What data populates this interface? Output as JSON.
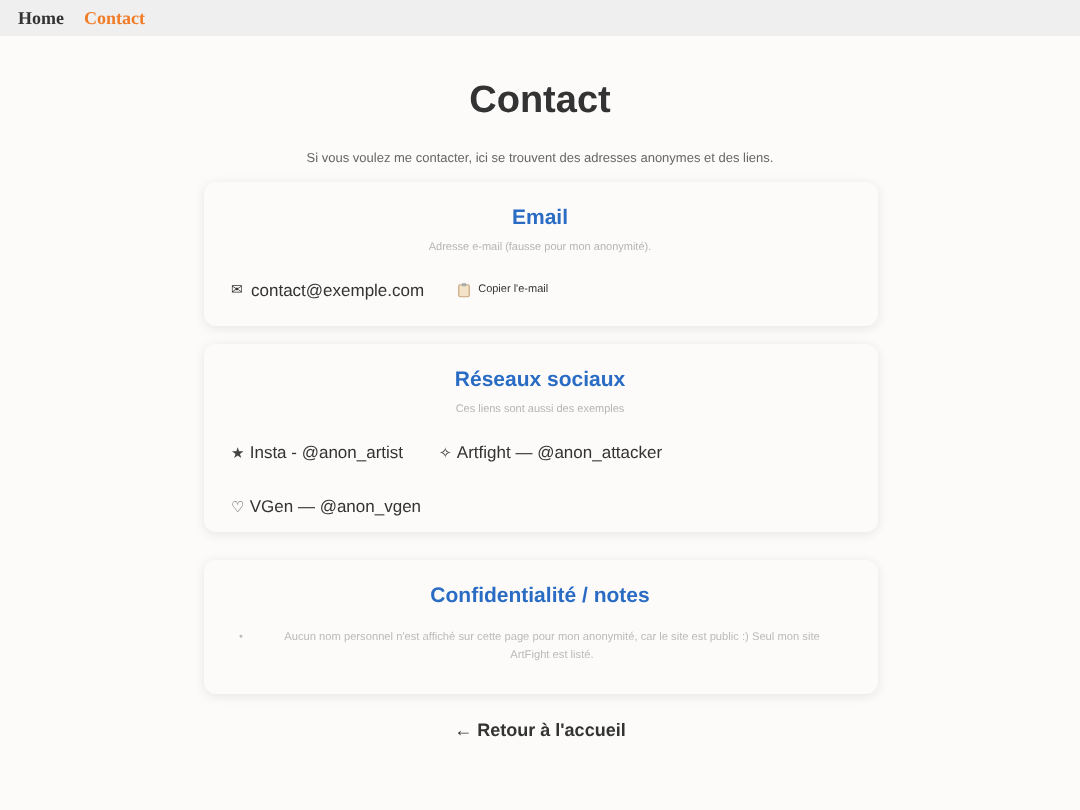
{
  "nav": [
    {
      "label": "Home",
      "selected": false
    },
    {
      "label": "Contact",
      "selected": true
    }
  ],
  "title": "Contact",
  "intro": "Si vous voulez me contacter, ici se trouvent des adresses anonymes et des liens.",
  "email": {
    "title": "Email",
    "subtitle": "Adresse e-mail (fausse pour mon anonymité).",
    "icon": "✉",
    "address": "contact@exemple.com",
    "copy_button": "Copier l'e-mail"
  },
  "social": {
    "title": "Réseaux sociaux",
    "subtitle": "Ces liens sont aussi des exemples",
    "links": [
      {
        "icon": "★",
        "label": "Insta - @anon_artist"
      },
      {
        "icon": "✧",
        "label": "Artfight — @anon_attacker"
      },
      {
        "icon": "♡",
        "label": "VGen — @anon_vgen"
      }
    ]
  },
  "privacy": {
    "title": "Confidentialité / notes",
    "notes": [
      {
        "bullet": "•",
        "text": "Aucun nom personnel n'est affiché sur cette page pour mon anonymité, car le site est public :) Seul mon site ArtFight est listé."
      }
    ]
  },
  "back_link": "← Retour à l'accueil"
}
